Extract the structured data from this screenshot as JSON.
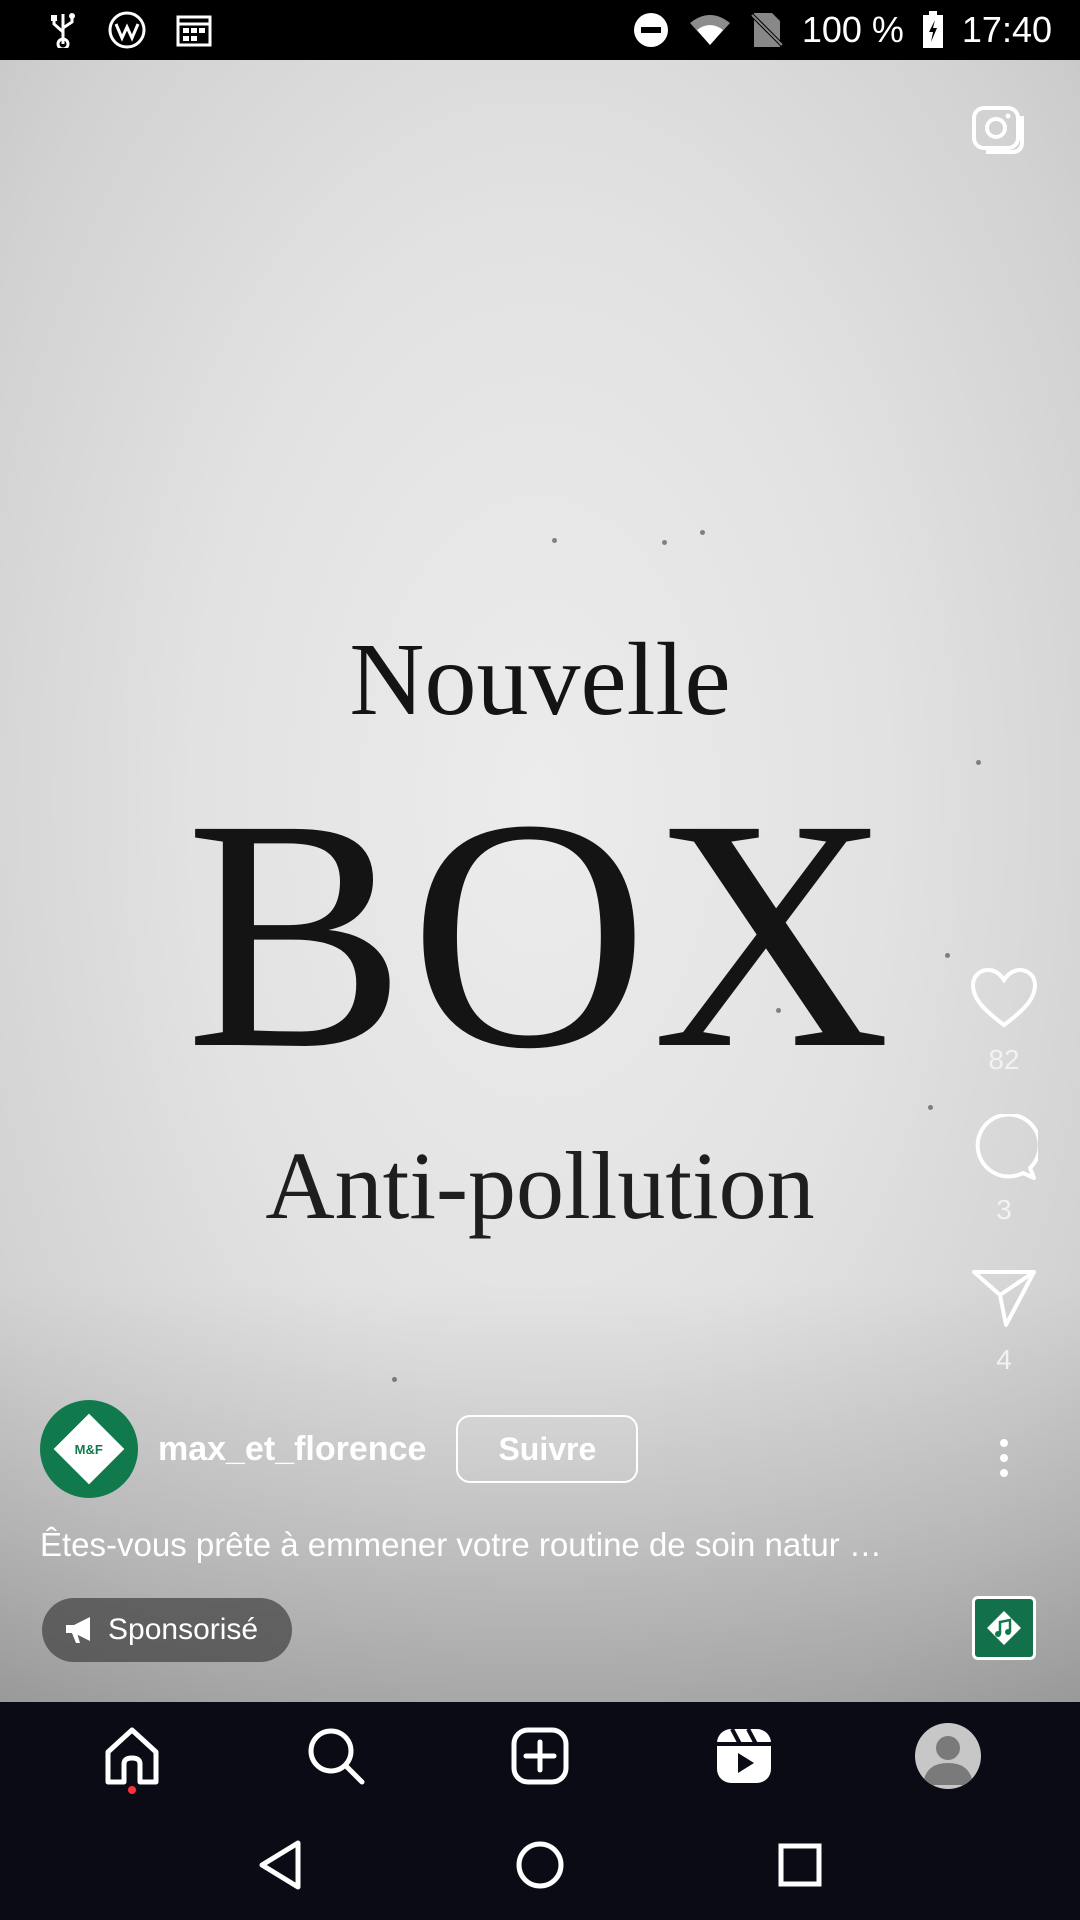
{
  "status_bar": {
    "battery": "100 %",
    "time": "17:40"
  },
  "video": {
    "headline_1": "Nouvelle",
    "headline_2": "BOX",
    "headline_3": "Anti-pollution"
  },
  "actions": {
    "likes": "82",
    "comments": "3",
    "shares": "4"
  },
  "post": {
    "avatar_text": "M&F",
    "username": "max_et_florence",
    "follow_label": "Suivre",
    "caption": "Êtes-vous prête à emmener votre routine de soin natur …",
    "sponsored_label": "Sponsorisé"
  },
  "colors": {
    "brand_green": "#107a4c",
    "nav_bg": "#0a0b14",
    "notification_dot": "#ff3040"
  },
  "icons": [
    "usb-icon",
    "app-icon",
    "calendar-icon",
    "dnd-icon",
    "wifi-icon",
    "no-sim-icon",
    "battery-icon",
    "camera-icon",
    "heart-icon",
    "comment-icon",
    "share-icon",
    "more-icon",
    "megaphone-icon",
    "home-icon",
    "search-icon",
    "create-icon",
    "reels-icon",
    "profile-icon",
    "back-icon",
    "home-circle-icon",
    "recents-icon"
  ]
}
